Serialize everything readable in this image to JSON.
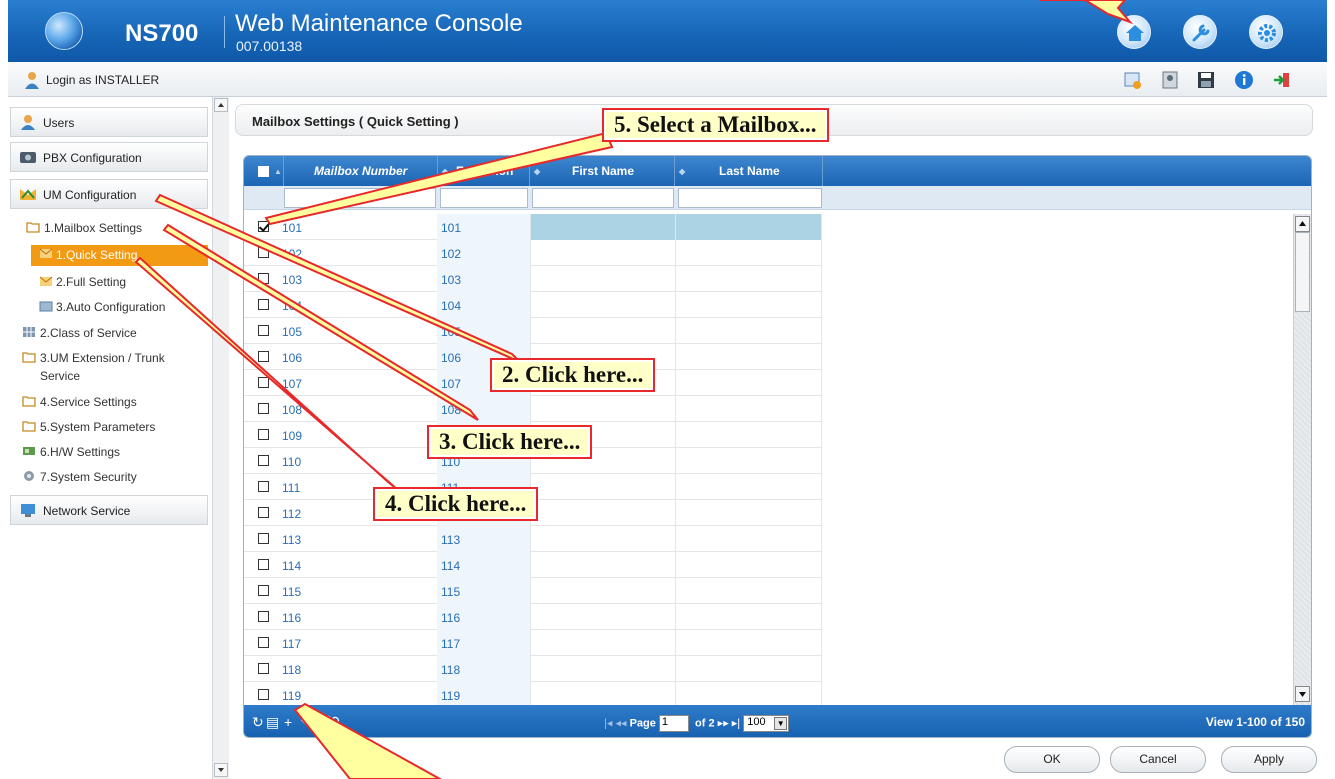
{
  "header": {
    "model": "NS700",
    "product": "Web Maintenance Console",
    "version": "007.00138",
    "buttons": [
      "home-icon",
      "wrench-icon",
      "gear-icon"
    ]
  },
  "login": {
    "text": "Login as INSTALLER"
  },
  "toolbar_icons": [
    "calendar-alert-icon",
    "contacts-icon",
    "save-icon",
    "info-icon",
    "logout-icon"
  ],
  "sidebar": {
    "users": "Users",
    "pbx": "PBX Configuration",
    "um": "UM Configuration",
    "tree": [
      {
        "label": "1.Mailbox Settings"
      },
      {
        "label": "1.Quick Setting"
      },
      {
        "label": "2.Full Setting"
      },
      {
        "label": "3.Auto Configuration"
      },
      {
        "label": "2.Class of Service"
      },
      {
        "label": "3.UM Extension / Trunk"
      },
      {
        "label": "Service"
      },
      {
        "label": "4.Service Settings"
      },
      {
        "label": "5.System Parameters"
      },
      {
        "label": "6.H/W Settings"
      },
      {
        "label": "7.System Security"
      }
    ],
    "network": "Network Service"
  },
  "panel": {
    "title": "Mailbox Settings ( Quick Setting )"
  },
  "grid": {
    "columns": [
      "Mailbox Number",
      "Extension",
      "First Name",
      "Last Name"
    ],
    "rows": [
      {
        "mailbox": "101",
        "extension": "101",
        "checked": true
      },
      {
        "mailbox": "102",
        "extension": "102"
      },
      {
        "mailbox": "103",
        "extension": "103"
      },
      {
        "mailbox": "104",
        "extension": "104"
      },
      {
        "mailbox": "105",
        "extension": "105"
      },
      {
        "mailbox": "106",
        "extension": "106"
      },
      {
        "mailbox": "107",
        "extension": "107"
      },
      {
        "mailbox": "108",
        "extension": "108"
      },
      {
        "mailbox": "109",
        "extension": "109"
      },
      {
        "mailbox": "110",
        "extension": "110"
      },
      {
        "mailbox": "111",
        "extension": "111"
      },
      {
        "mailbox": "112",
        "extension": "112"
      },
      {
        "mailbox": "113",
        "extension": "113"
      },
      {
        "mailbox": "114",
        "extension": "114"
      },
      {
        "mailbox": "115",
        "extension": "115"
      },
      {
        "mailbox": "116",
        "extension": "116"
      },
      {
        "mailbox": "117",
        "extension": "117"
      },
      {
        "mailbox": "118",
        "extension": "118"
      },
      {
        "mailbox": "119",
        "extension": "119"
      }
    ],
    "pager": {
      "page_label": "Page",
      "page": "1",
      "of_label": "of 2",
      "per_page": "100"
    },
    "view": "View 1-100 of 150"
  },
  "actions": {
    "ok": "OK",
    "cancel": "Cancel",
    "apply": "Apply"
  },
  "callouts": {
    "c5": "5. Select a Mailbox...",
    "c2": "2. Click here...",
    "c3": "3. Click here...",
    "c4": "4. Click here..."
  },
  "colors": {
    "header": "#1766b8",
    "selected": "#f29a14",
    "callout_border": "#e8282a",
    "callout_bg": "#ffffc8",
    "row_highlight": "#acd3e4"
  }
}
